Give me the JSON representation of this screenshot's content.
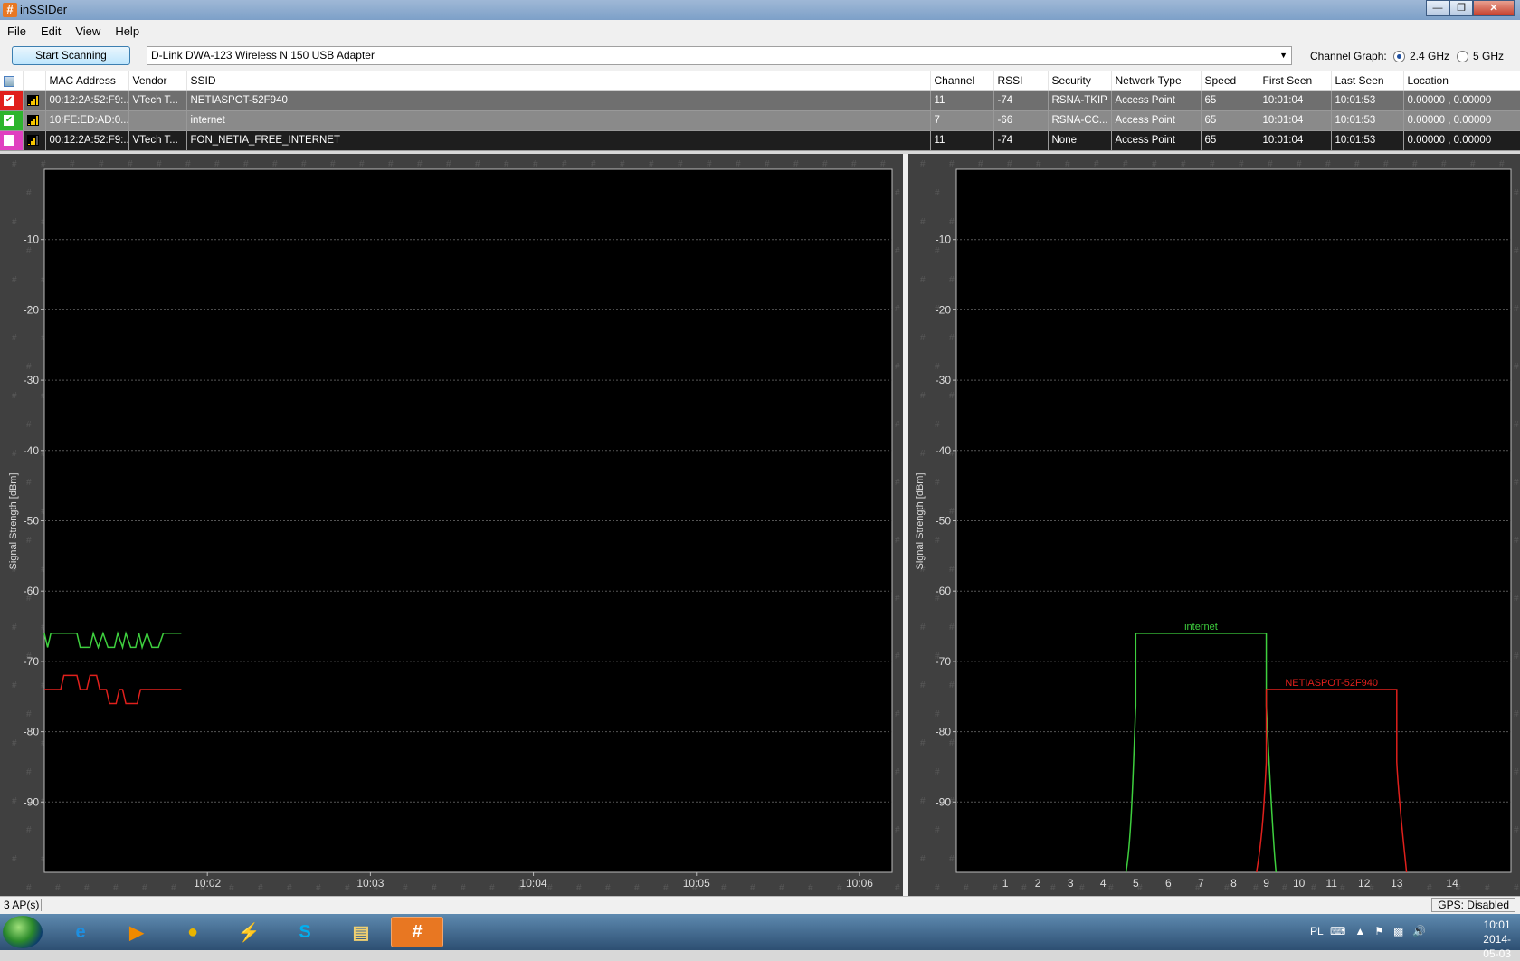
{
  "window": {
    "title": "inSSIDer",
    "app_icon": "#"
  },
  "menu": [
    "File",
    "Edit",
    "View",
    "Help"
  ],
  "toolbar": {
    "scan_button": "Start Scanning",
    "adapter": "D-Link DWA-123 Wireless N 150 USB Adapter",
    "channel_graph_label": "Channel Graph:",
    "band_options": [
      {
        "label": "2.4 GHz",
        "selected": true
      },
      {
        "label": "5 GHz",
        "selected": false
      }
    ]
  },
  "table": {
    "columns": [
      "MAC Address",
      "Vendor",
      "SSID",
      "Channel",
      "RSSI",
      "Security",
      "Network Type",
      "Speed",
      "First Seen",
      "Last Seen",
      "Location"
    ],
    "rows": [
      {
        "color": "#e0201c",
        "checked": true,
        "bars": 4,
        "mac": "00:12:2A:52:F9:...",
        "vendor": "VTech T...",
        "ssid": "NETIASPOT-52F940",
        "channel": "11",
        "rssi": "-74",
        "security": "RSNA-TKIP",
        "network_type": "Access Point",
        "speed": "65",
        "first_seen": "10:01:04",
        "last_seen": "10:01:53",
        "location": "0.00000 , 0.00000"
      },
      {
        "color": "#2db52d",
        "checked": true,
        "bars": 4,
        "mac": "10:FE:ED:AD:0...",
        "vendor": "",
        "ssid": "internet",
        "channel": "7",
        "rssi": "-66",
        "security": "RSNA-CC...",
        "network_type": "Access Point",
        "speed": "65",
        "first_seen": "10:01:04",
        "last_seen": "10:01:53",
        "location": "0.00000 , 0.00000"
      },
      {
        "color": "#e040c0",
        "checked": false,
        "bars": 3,
        "mac": "00:12:2A:52:F9:...",
        "vendor": "VTech T...",
        "ssid": "FON_NETIA_FREE_INTERNET",
        "channel": "11",
        "rssi": "-74",
        "security": "None",
        "network_type": "Access Point",
        "speed": "65",
        "first_seen": "10:01:04",
        "last_seen": "10:01:53",
        "location": "0.00000 , 0.00000"
      }
    ]
  },
  "chart_data": [
    {
      "type": "line",
      "ylabel": "Signal Strength [dBm]",
      "ylim": [
        -100,
        0
      ],
      "yticks": [
        -10,
        -20,
        -30,
        -40,
        -50,
        -60,
        -70,
        -80,
        -90
      ],
      "x_ticks": [
        "10:02",
        "10:03",
        "10:04",
        "10:05",
        "10:06"
      ],
      "xlim_minutes": [
        0,
        5.2
      ],
      "grid": true,
      "series": [
        {
          "name": "internet",
          "color": "#3ecf3e",
          "points": [
            [
              0.0,
              -66
            ],
            [
              0.02,
              -68
            ],
            [
              0.04,
              -66
            ],
            [
              0.2,
              -66
            ],
            [
              0.22,
              -68
            ],
            [
              0.28,
              -68
            ],
            [
              0.3,
              -66
            ],
            [
              0.33,
              -68
            ],
            [
              0.36,
              -66
            ],
            [
              0.39,
              -68
            ],
            [
              0.43,
              -68
            ],
            [
              0.45,
              -66
            ],
            [
              0.48,
              -68
            ],
            [
              0.5,
              -66
            ],
            [
              0.53,
              -68
            ],
            [
              0.56,
              -68
            ],
            [
              0.58,
              -66
            ],
            [
              0.6,
              -68
            ],
            [
              0.63,
              -66
            ],
            [
              0.66,
              -68
            ],
            [
              0.7,
              -68
            ],
            [
              0.73,
              -66
            ],
            [
              0.84,
              -66
            ]
          ]
        },
        {
          "name": "NETIASPOT-52F940",
          "color": "#e0201c",
          "points": [
            [
              0.0,
              -74
            ],
            [
              0.1,
              -74
            ],
            [
              0.12,
              -72
            ],
            [
              0.2,
              -72
            ],
            [
              0.22,
              -74
            ],
            [
              0.26,
              -74
            ],
            [
              0.28,
              -72
            ],
            [
              0.32,
              -72
            ],
            [
              0.34,
              -74
            ],
            [
              0.38,
              -74
            ],
            [
              0.4,
              -76
            ],
            [
              0.44,
              -76
            ],
            [
              0.46,
              -74
            ],
            [
              0.48,
              -74
            ],
            [
              0.5,
              -76
            ],
            [
              0.57,
              -76
            ],
            [
              0.59,
              -74
            ],
            [
              0.84,
              -74
            ]
          ]
        }
      ]
    },
    {
      "type": "area",
      "ylabel": "Signal Strength [dBm]",
      "ylim": [
        -100,
        0
      ],
      "yticks": [
        -10,
        -20,
        -30,
        -40,
        -50,
        -60,
        -70,
        -80,
        -90
      ],
      "x_ticks": [
        1,
        2,
        3,
        4,
        5,
        6,
        7,
        8,
        9,
        10,
        11,
        12,
        13,
        14
      ],
      "xlim": [
        -0.5,
        16.5
      ],
      "grid": true,
      "series": [
        {
          "name": "internet",
          "color": "#3ecf3e",
          "channel": 7,
          "rssi": -66
        },
        {
          "name": "NETIASPOT-52F940",
          "color": "#e0201c",
          "channel": 11,
          "rssi": -74
        }
      ]
    }
  ],
  "status": {
    "aps": "3 AP(s)",
    "gps": "GPS: Disabled"
  },
  "taskbar": {
    "apps": [
      {
        "name": "ie-icon",
        "glyph": "e",
        "color": "#1e8fe0"
      },
      {
        "name": "media-player-icon",
        "glyph": "▶",
        "color": "#f08a00"
      },
      {
        "name": "chrome-icon",
        "glyph": "●",
        "color": "#e8b400"
      },
      {
        "name": "lightning-app-icon",
        "glyph": "⚡",
        "color": "#e8e8e8"
      },
      {
        "name": "skype-icon",
        "glyph": "S",
        "color": "#00aff0"
      },
      {
        "name": "explorer-icon",
        "glyph": "▤",
        "color": "#f0d070"
      },
      {
        "name": "inssider-icon",
        "glyph": "#",
        "color": "#ffffff"
      }
    ],
    "lang": "PL",
    "time": "10:01",
    "date": "2014-05-03"
  }
}
